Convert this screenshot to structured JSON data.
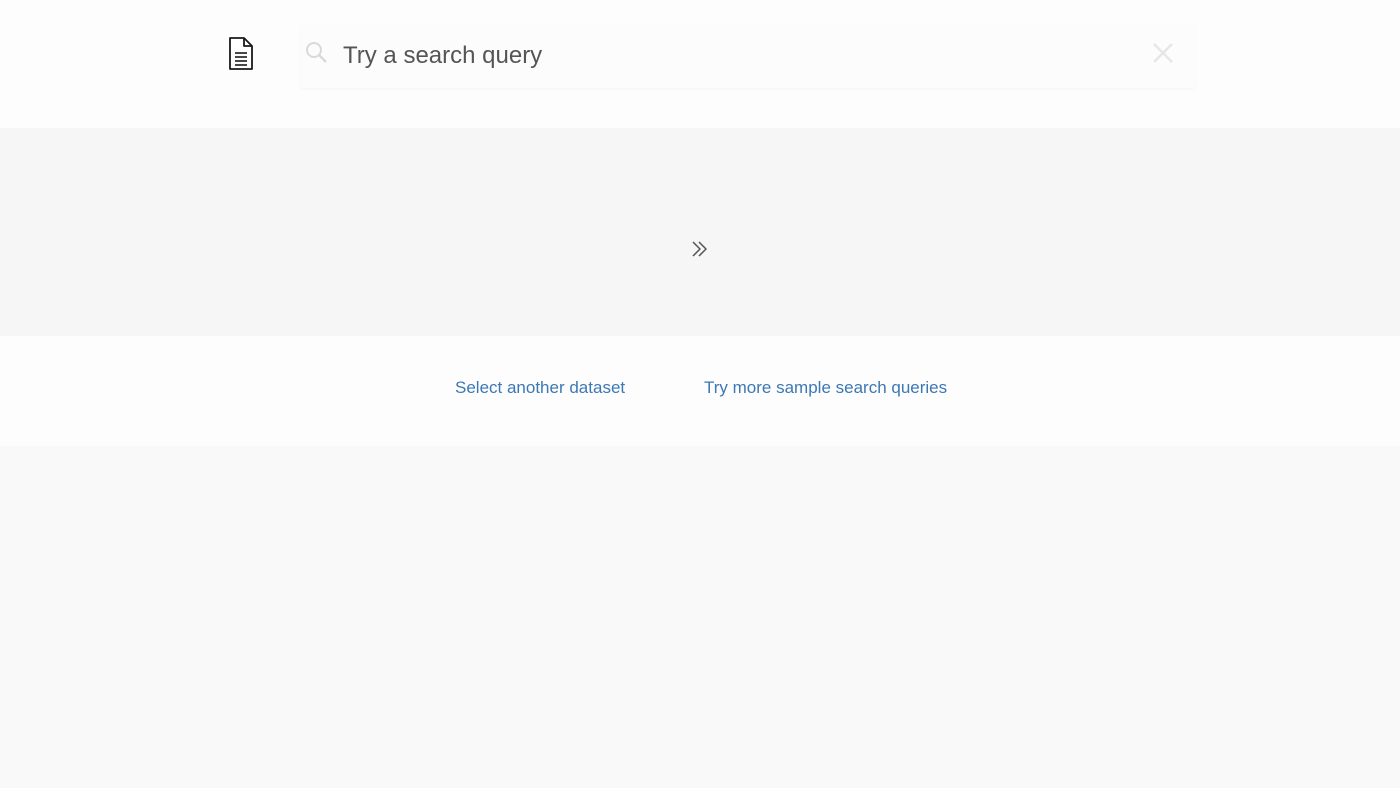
{
  "header": {
    "document_icon": "document-icon",
    "search": {
      "value": "",
      "placeholder": "Try a search query",
      "search_icon": "search-icon",
      "clear_icon": "clear-icon"
    }
  },
  "results": {
    "expand_icon": "double-chevron-right-icon"
  },
  "links": {
    "select_dataset": "Select another dataset",
    "sample_queries": "Try more sample search queries"
  },
  "colors": {
    "link": "#3c78b4",
    "background": "#fafafa",
    "panel": "#f6f6f6"
  }
}
